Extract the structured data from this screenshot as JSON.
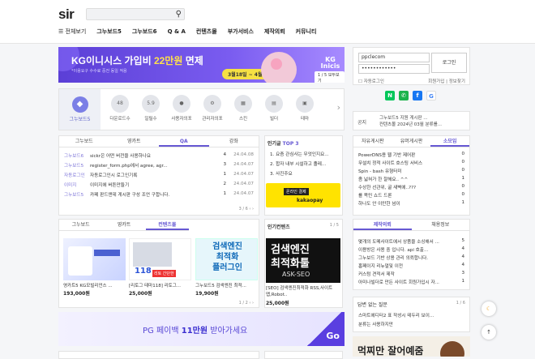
{
  "header": {
    "logo": "sir",
    "search_icon": "search-icon"
  },
  "nav": {
    "all": "전체보기",
    "items": [
      "그누보드5",
      "그누보드6",
      "Q & A",
      "컨텐츠몰",
      "부가서비스",
      "제작의뢰",
      "커뮤니티"
    ]
  },
  "banner": {
    "title_a": "KG이니시스 가입비 ",
    "title_b": "22만원",
    "title_c": " 면제",
    "sub": "*이용요구 수수료 중전 동일 적용",
    "date": "3월18일 ~ 4월30일",
    "brand": "KG Inicis",
    "pager": "1 / 5  모두보기"
  },
  "login": {
    "username": "ppclecom",
    "password": "••••••••••••",
    "button": "로그인",
    "auto": "자동로그인",
    "join": "회원가입",
    "find": "정보찾기",
    "social": [
      "N",
      "✆",
      "f",
      "G"
    ]
  },
  "icons": {
    "first": "그누보드5",
    "items": [
      {
        "top": "48",
        "label": "다운로드수"
      },
      {
        "top": "5.9",
        "label": "일릴수"
      },
      {
        "top": "",
        "label": "사용자의포"
      },
      {
        "top": "",
        "label": "관리자의포"
      },
      {
        "top": "",
        "label": "스킨"
      },
      {
        "top": "",
        "label": "빌더"
      },
      {
        "top": "",
        "label": "테마"
      }
    ]
  },
  "notice": {
    "key": "공지",
    "lines": [
      "그누보드5 지원 게시판 ...",
      "컨텐츠몰 2024년 03월 분류를..."
    ]
  },
  "qa": {
    "tabs": [
      "그누보드",
      "영카트",
      "QA",
      "강좌"
    ],
    "rows": [
      {
        "cat": "그누보드6",
        "text": "sickr은 어떤 버전을 사용하나요",
        "cnt": "4",
        "date": "24.04.08"
      },
      {
        "cat": "그누보드5",
        "text": "register_form.php에서 agree, agr...",
        "cnt": "3",
        "date": "24.04.07"
      },
      {
        "cat": "자동로그인",
        "text": "자동로그인시 로그인기록",
        "cnt": "1",
        "date": "24.04.07"
      },
      {
        "cat": "이미지",
        "text": "이미지에 버튼만들기",
        "cnt": "2",
        "date": "24.04.07"
      },
      {
        "cat": "그누보드5",
        "text": "카페 판드앤데 게시판 구성 조언 구합니다.",
        "cnt": "1",
        "date": "24.04.07"
      }
    ],
    "pager": "3 / 6"
  },
  "popular": {
    "title": "인기글",
    "top": "TOP 3",
    "rows": [
      "1. 요즘 관심사는 무엇인지요...",
      "2. 합자 내부 시설하고 졸레...",
      "3. 사진주요"
    ],
    "ad_a": "온라인 결제",
    "ad_b": "kakaopay"
  },
  "community": {
    "tabs": [
      "자유게시판",
      "유머게시판",
      "소모임"
    ],
    "rows": [
      {
        "t": "PowerDNS용 웹 기반 제어판",
        "n": "0"
      },
      {
        "t": "무설치 정적 사이트 호스팅 서비스",
        "n": "0"
      },
      {
        "t": "Spin - bash 유형터미",
        "n": "0"
      },
      {
        "t": "좀 넓혀가 한 잘해요.. ^^",
        "n": "1"
      },
      {
        "t": "수상한 선관위, 굴 새벽에..???",
        "n": "0"
      },
      {
        "t": "를 목민 쇼드 드론",
        "n": "0"
      },
      {
        "t": "하나도 안 이만한 넘이",
        "n": "1"
      }
    ]
  },
  "shop": {
    "tabs": [
      "그누보드",
      "영카트",
      "컨텐츠몰"
    ],
    "products": [
      {
        "name": "영카트5 KG모빌리언스 ...",
        "price": "193,000원"
      },
      {
        "name": "[리토그 테마118] 리토그...",
        "price": "25,000원"
      },
      {
        "name": "그누보드5 검색엔진 최적...",
        "price": "19,900원"
      }
    ],
    "pager": "1 / 2"
  },
  "content_popular": {
    "title": "인기컨텐츠",
    "pager": "1 / 5",
    "ad_a": "검색엔진",
    "ad_b": "최적화툴",
    "ad_c": "ASK-SEO",
    "name": "[SEO] 검색엔진최적화 RSS,사이트맵,Robot..",
    "price": "25,000원",
    "thumb3_a": "검색엔진",
    "thumb3_b": "최적화",
    "thumb3_c": "플러그인",
    "thumb2_a": "118",
    "thumb2_b": "리토 간단한"
  },
  "request": {
    "tabs": [
      "제작의뢰",
      "채용정보"
    ],
    "rows": [
      {
        "t": "몇개의 도메사이트에서 상품을 소싱해서 ...",
        "n": "5"
      },
      {
        "t": "이용방은 사용 중 입니다. api 호출...",
        "n": "4"
      },
      {
        "t": "그누보드 기반 상용 관리 의뢰합니다.",
        "n": "4"
      },
      {
        "t": "홈페이지 리뉴얼및 이전",
        "n": "4"
      },
      {
        "t": "커스텀 견적서 제작",
        "n": "3"
      },
      {
        "t": "아미나빌더로 만든 사이트 회원가입시 자...",
        "n": "1"
      }
    ]
  },
  "unanswered": {
    "title": "답변 없는 질문",
    "pager": "1 / 6",
    "rows": [
      "스마트에디터2 표 작성시 테두리 보이...",
      "분류는 사용하지만"
    ]
  },
  "pgad": {
    "a": "PG 페이백 ",
    "b": "11만원",
    "c": " 받아가세요",
    "go": "Go"
  },
  "bottom_ad": "먹찌만 잘어예줌",
  "colors": {
    "accent": "#6658d3",
    "banner": "#5b3fd6",
    "kakao": "#ffe300"
  }
}
